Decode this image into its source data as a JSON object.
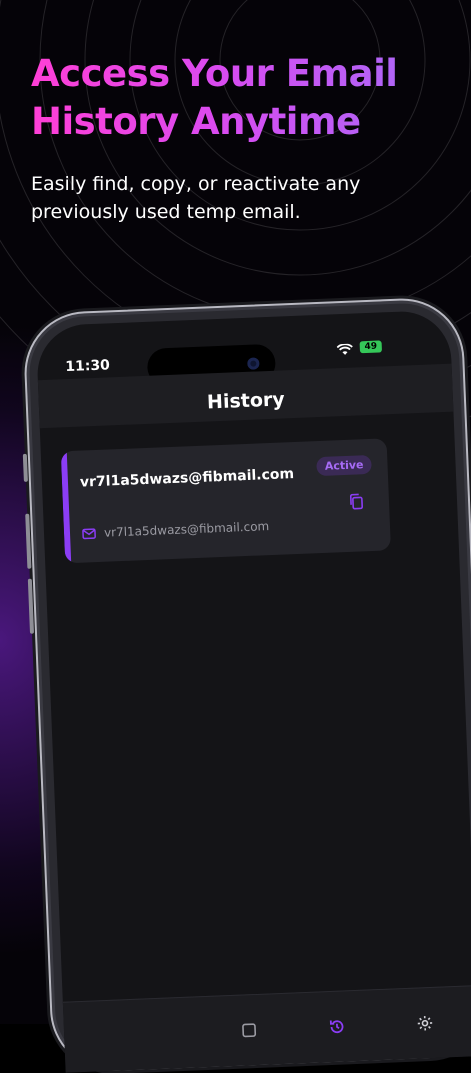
{
  "headline": {
    "line1": "Access Your Email",
    "line2": "History Anytime"
  },
  "subtitle": {
    "line1": "Easily find, copy, or reactivate any",
    "line2": "previously used temp email."
  },
  "status_bar": {
    "time": "11:30",
    "battery": "49"
  },
  "screen": {
    "title": "History",
    "history_items": [
      {
        "email": "vr7l1a5dwazs@fibmail.com",
        "badge": "Active",
        "address": "vr7l1a5dwazs@fibmail.com"
      }
    ]
  },
  "tabbar": {
    "tabs": [
      {
        "icon": "mailbox-icon"
      },
      {
        "icon": "history-icon",
        "active": true
      },
      {
        "icon": "gear-icon"
      }
    ]
  },
  "colors": {
    "accent": "#8b3df5",
    "headline_gradient_start": "#ff3fd6",
    "headline_gradient_end": "#a46cf8",
    "card": "#25252b",
    "screen_bg": "#141417"
  }
}
